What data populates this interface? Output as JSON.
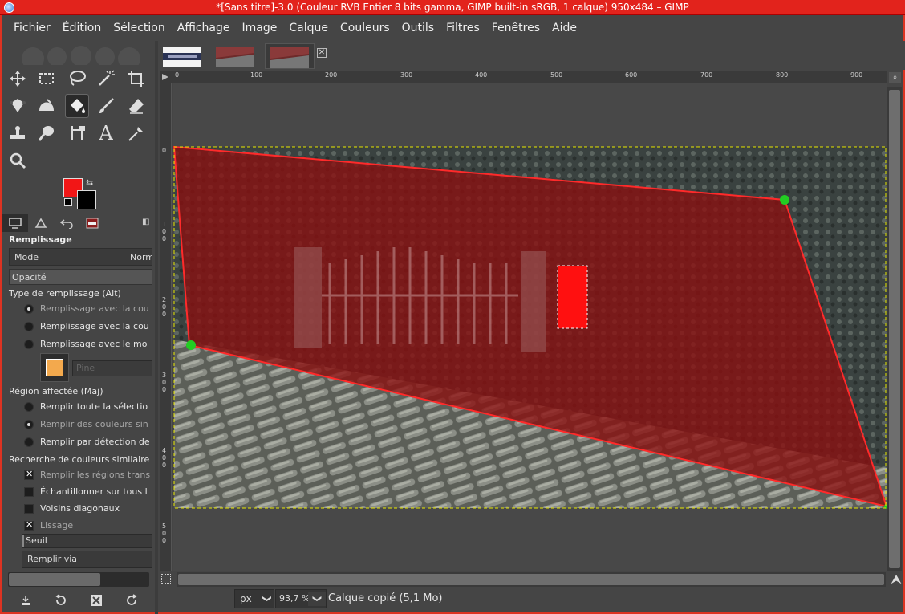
{
  "window": {
    "title": "*[Sans titre]-3.0 (Couleur RVB Entier 8 bits gamma, GIMP built-in sRGB, 1 calque) 950x484 – GIMP"
  },
  "menu": [
    "Fichier",
    "Édition",
    "Sélection",
    "Affichage",
    "Image",
    "Calque",
    "Couleurs",
    "Outils",
    "Filtres",
    "Fenêtres",
    "Aide"
  ],
  "tools": [
    "move-tool",
    "rect-select-tool",
    "lasso-tool",
    "fuzzy-select-tool",
    "crop-tool",
    "unified-transform-tool",
    "warp-tool",
    "bucket-fill-tool",
    "paintbrush-tool",
    "eraser-tool",
    "clone-tool",
    "smudge-tool",
    "paths-tool",
    "text-tool",
    "color-picker-tool",
    "zoom-tool"
  ],
  "colors": {
    "foreground": "#f21616",
    "background": "#000000",
    "accent": "#e2231c"
  },
  "tool_options": {
    "title": "Remplissage",
    "mode_label": "Mode",
    "mode_value": "Norm",
    "opacity_label": "Opacité",
    "fill_type_heading": "Type de remplissage  (Alt)",
    "fill_type_options": [
      {
        "label": "Remplissage avec la cou",
        "selected": true
      },
      {
        "label": "Remplissage avec la cou",
        "selected": false
      },
      {
        "label": "Remplissage avec le mo",
        "selected": false
      }
    ],
    "pattern_placeholder": "Pine",
    "region_heading": "Région affectée  (Maj)",
    "region_options": [
      {
        "label": "Remplir toute la sélectio",
        "selected": false
      },
      {
        "label": "Remplir des couleurs sin",
        "selected": true
      },
      {
        "label": "Remplir par détection de",
        "selected": false
      }
    ],
    "similar_heading": "Recherche de couleurs similaire",
    "similar_options": [
      {
        "label": "Remplir les régions trans",
        "checked": true
      },
      {
        "label": "Échantillonner sur tous l",
        "checked": false
      },
      {
        "label": "Voisins diagonaux",
        "checked": false
      },
      {
        "label": "Lissage",
        "checked": true
      }
    ],
    "threshold_label": "Seuil",
    "fill_via_label": "Remplir via"
  },
  "left_bottom_icons": [
    "save-preset-icon",
    "restore-icon",
    "delete-preset-icon",
    "reset-icon"
  ],
  "ruler_h_labels": [
    "0",
    "100",
    "200",
    "300",
    "400",
    "500",
    "600",
    "700",
    "800",
    "900"
  ],
  "ruler_v_labels": [
    "0",
    "1\n0\n0",
    "2\n0\n0",
    "3\n0\n0",
    "4\n0\n0",
    "5\n0\n0"
  ],
  "status": {
    "unit": "px",
    "zoom": "93,7 %",
    "message": "Calque copié (5,1 Mo)"
  }
}
